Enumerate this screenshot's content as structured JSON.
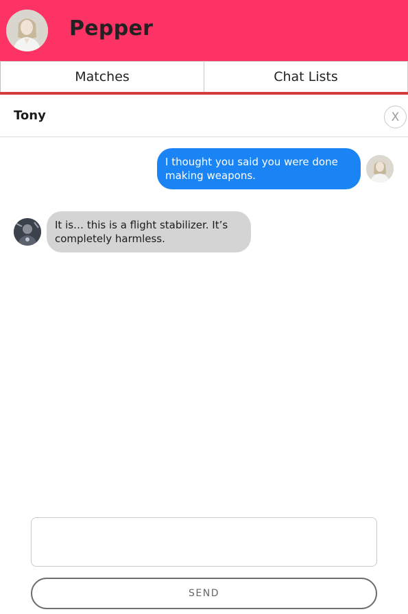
{
  "header": {
    "name": "Pepper"
  },
  "tabs": [
    {
      "label": "Matches"
    },
    {
      "label": "Chat Lists"
    }
  ],
  "chat": {
    "title": "Tony",
    "close_label": "X",
    "messages": [
      {
        "direction": "sent",
        "text": "I thought you said you were done making weapons."
      },
      {
        "direction": "received",
        "text": "It is… this is a flight stabilizer. It’s completely harmless."
      }
    ]
  },
  "composer": {
    "value": "",
    "placeholder": ""
  },
  "send": {
    "label": "SEND"
  },
  "colors": {
    "header_bg": "#fe3365",
    "tab_underline": "#d63a3f",
    "sent_bubble": "#1a84f5",
    "received_bubble": "#d4d4d4"
  }
}
